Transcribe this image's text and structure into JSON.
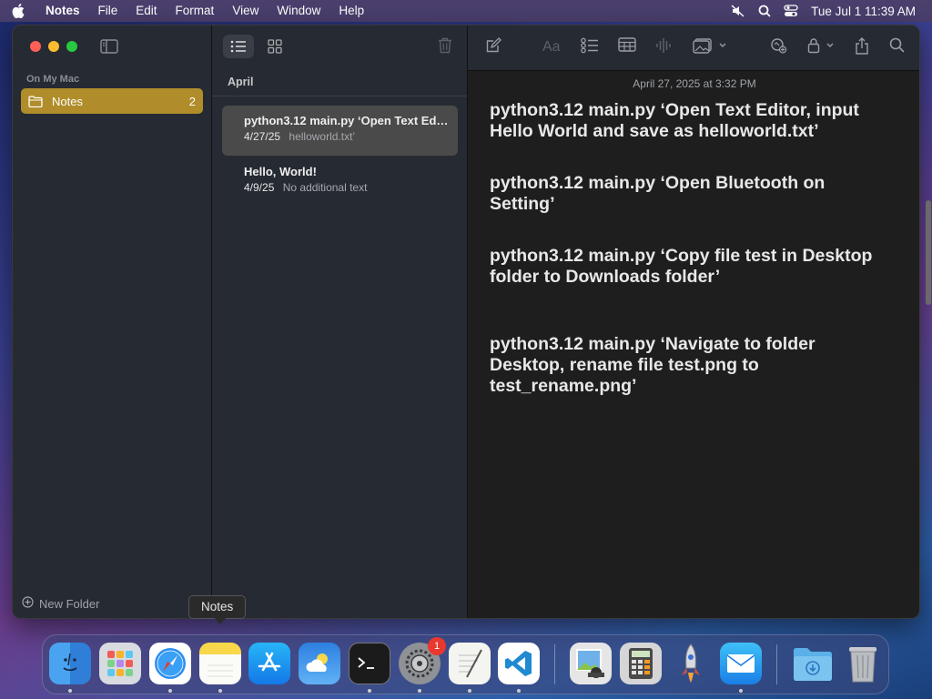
{
  "menubar": {
    "app_name": "Notes",
    "menus": [
      "File",
      "Edit",
      "Format",
      "View",
      "Window",
      "Help"
    ],
    "clock": "Tue Jul 1  11:39 AM"
  },
  "sidebar": {
    "section_label": "On My Mac",
    "folders": [
      {
        "name": "Notes",
        "count": "2"
      }
    ],
    "new_folder_label": "New Folder"
  },
  "note_list": {
    "month": "April",
    "notes": [
      {
        "title": "python3.12 main.py ‘Open Text Editor, input Hello World and save as helloworld.txt’",
        "date": "4/27/25",
        "preview": "helloworld.txt’"
      },
      {
        "title": "Hello, World!",
        "date": "4/9/25",
        "preview": "No additional text"
      }
    ]
  },
  "editor": {
    "date": "April 27, 2025 at 3:32 PM",
    "paragraphs": [
      "python3.12 main.py ‘Open Text Editor, input Hello World and save as helloworld.txt’",
      "python3.12 main.py ‘Open Bluetooth on Setting’",
      "python3.12 main.py ‘Copy file test in Desktop folder to Downloads folder’",
      "python3.12 main.py ‘Navigate to folder Desktop, rename file test.png to test_rename.png’"
    ]
  },
  "tooltip": "Notes",
  "dock": {
    "apps": [
      "finder",
      "launchpad",
      "safari",
      "notes",
      "app-store",
      "weather",
      "terminal",
      "system-settings",
      "textedit",
      "vscode",
      "preview",
      "calculator",
      "rocket",
      "mail",
      "downloads",
      "trash"
    ],
    "settings_badge": "1"
  },
  "colors": {
    "accent": "#b08d2a",
    "sidebar_bg": "#262a33",
    "editor_bg": "#1e1e1e"
  }
}
